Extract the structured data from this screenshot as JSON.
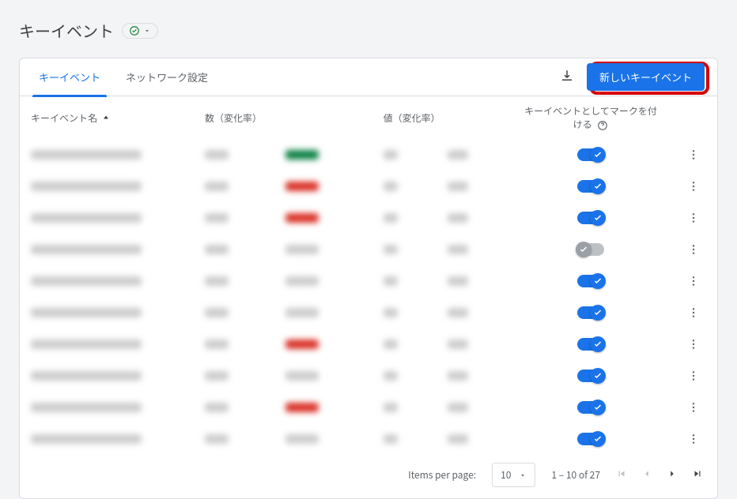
{
  "page_title": "キーイベント",
  "tabs": {
    "key_events": "キーイベント",
    "network": "ネットワーク設定"
  },
  "actions": {
    "new_event": "新しいキーイベント"
  },
  "columns": {
    "name": "キーイベント名",
    "count": "数（変化率）",
    "value": "値（変化率）",
    "mark": "キーイベントとしてマークを付ける"
  },
  "rows": [
    {
      "on": true,
      "c2_color": "green"
    },
    {
      "on": true,
      "c2_color": "red"
    },
    {
      "on": true,
      "c2_color": "red"
    },
    {
      "on": false,
      "c2_color": ""
    },
    {
      "on": true,
      "c2_color": ""
    },
    {
      "on": true,
      "c2_color": ""
    },
    {
      "on": true,
      "c2_color": "red"
    },
    {
      "on": true,
      "c2_color": ""
    },
    {
      "on": true,
      "c2_color": "red"
    },
    {
      "on": true,
      "c2_color": ""
    }
  ],
  "footer": {
    "items_per_page_label": "Items per page:",
    "items_per_page_value": "10",
    "range": "1 – 10 of 27"
  }
}
